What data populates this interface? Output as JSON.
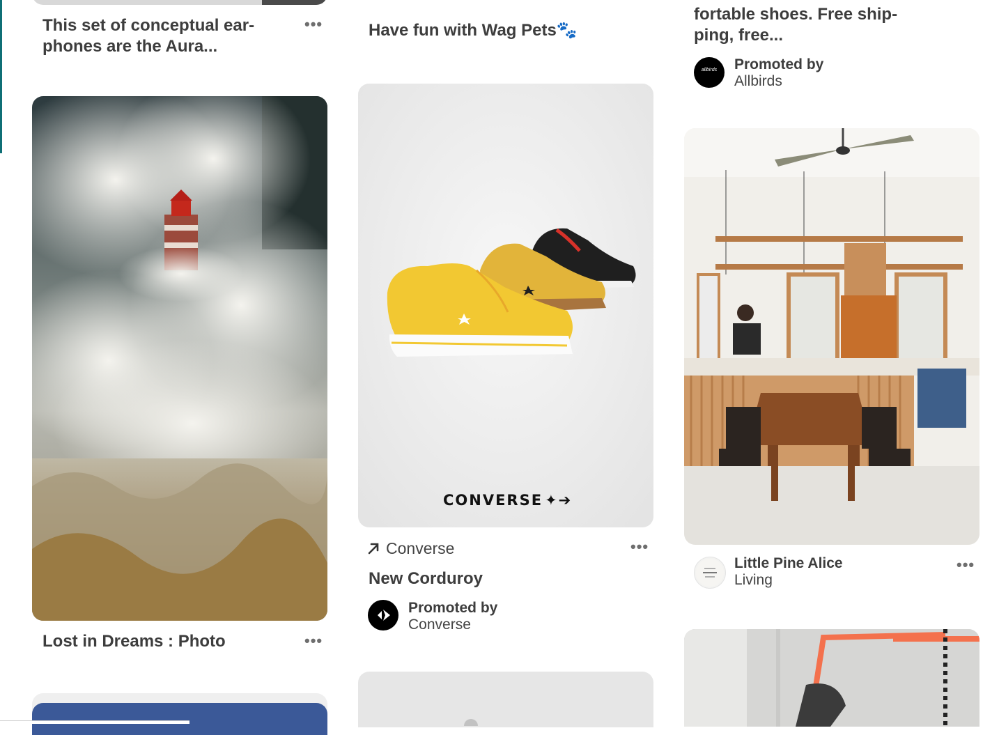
{
  "pins": {
    "earphones": {
      "title": "This set of conceptual ear-phones are the Aura..."
    },
    "lighthouse": {
      "title": "Lost in Dreams : Photo"
    },
    "wag": {
      "title": "Have fun with Wag Pets🐾"
    },
    "converse": {
      "brand_logo": "CONVERSE",
      "link": "Converse",
      "title": "New Corduroy",
      "promoted_label": "Promoted by",
      "advertiser": "Converse"
    },
    "allbirds": {
      "title_line1": "fortable shoes. Free ship-",
      "title_line2": "ping, free...",
      "promoted_label": "Promoted by",
      "advertiser": "Allbirds",
      "avatar_text": "allbirds"
    },
    "kitchen": {
      "author_line1": "Little Pine Alice",
      "author_line2": "Living"
    }
  },
  "icons": {
    "more": "more-icon",
    "outbound": "arrow-up-right-icon"
  },
  "colors": {
    "accent_teal": "#0f6f76",
    "shoe_yellow": "#f2c832",
    "facebook_blue": "#3b5998"
  }
}
